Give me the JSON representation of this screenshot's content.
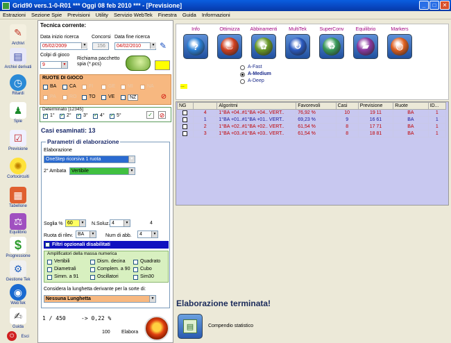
{
  "window": {
    "title": "Grid90 vers.1-0-R01  ***  Oggi 08 feb 2010  ***  - [Previsione]"
  },
  "menu": [
    "Estrazioni",
    "Sezione Spie",
    "Previsioni",
    "Utility",
    "Servizio WebTek",
    "Finestra",
    "Guida",
    "Informazioni"
  ],
  "sidebar": {
    "items": [
      {
        "label": "Archivi"
      },
      {
        "label": "Archivi derivati"
      },
      {
        "label": "Ritardi"
      },
      {
        "label": "Spie"
      },
      {
        "label": "Previsione"
      },
      {
        "label": "Cortocircuiti"
      },
      {
        "label": "Tabellone"
      },
      {
        "label": "Equilibrio"
      },
      {
        "label": "Progressione"
      },
      {
        "label": "Gestione Tek"
      },
      {
        "label": "WebTek"
      },
      {
        "label": "Guida"
      },
      {
        "label": "Esci"
      }
    ]
  },
  "tecnica": {
    "title": "Tecnica corrente:",
    "data_inizio_label": "Data inizio ricerca",
    "data_inizio": "05/02/2009",
    "concorsi_label": "Concorsi",
    "concorsi": "156",
    "data_fine_label": "Data fine ricerca",
    "data_fine": "04/02/2010",
    "colpi_label": "Colpi di gioco",
    "colpi": "9",
    "richiama_label": "Richiama pacchetto spia (*.pcs)",
    "ruote_title": "RUOTE DI GIOCO",
    "ruote": [
      {
        "name": "BA",
        "checked": false,
        "enabled": true
      },
      {
        "name": "CA",
        "checked": false,
        "enabled": true
      },
      {
        "name": "FI",
        "checked": false,
        "enabled": false
      },
      {
        "name": "GE",
        "checked": false,
        "enabled": false
      },
      {
        "name": "MI",
        "checked": false,
        "enabled": false
      },
      {
        "name": "NA",
        "checked": false,
        "enabled": false
      },
      {
        "name": "PA",
        "checked": false,
        "enabled": false
      },
      {
        "name": "RO",
        "checked": false,
        "enabled": false
      },
      {
        "name": "TO",
        "checked": false,
        "enabled": true
      },
      {
        "name": "VE",
        "checked": false,
        "enabled": true
      },
      {
        "name": "NZ",
        "checked": false,
        "enabled": true
      }
    ],
    "determinato_title": "Determinato [12345]",
    "determinato": [
      "1°",
      "2°",
      "3°",
      "4°",
      "5°"
    ],
    "casi_esaminati": "Casi esaminati: 13"
  },
  "parametri": {
    "title": "Parametri di elaborazione",
    "elaborazione_label": "Elaborazione",
    "elaborazione": "OneStep ricorsiva 1 ruota",
    "ambata_label": "2° Ambata",
    "ambata": "Vertibile",
    "soglia_label": "Soglia %",
    "soglia": "60",
    "nsoluz_label": "N.Soluz.",
    "nsoluz": "4",
    "nsoluz_value": "4",
    "ruota_rilev_label": "Ruota di rilev.",
    "ruota_rilev": "BA",
    "num_abb_label": "Num di abb.",
    "num_abb": "4",
    "filtri": "Filtri opzionali disabilitati",
    "amplificatori_title": "Amplificatori della massa numerica",
    "amplificatori": [
      "Vertibili",
      "Diametrali",
      "Simm. a 91",
      "Dism. decina",
      "Complem. a 90",
      "Oscillatori",
      "Quadrato",
      "Cubo",
      "Sim30"
    ],
    "lunghezza_label": "Considera la lunghetta derivante per la sorte di:",
    "lunghezza": "Nessuna Lunghetta"
  },
  "progress": {
    "count": "1 / 450",
    "pct": "-> 0,22 %",
    "value": "100",
    "elabora": "Elabora"
  },
  "tools": [
    {
      "label": "Info",
      "symbol": "?",
      "color": "#2a7fd6"
    },
    {
      "label": "Ottimizza",
      "symbol": "♨",
      "color": "#d04020"
    },
    {
      "label": "Abbinamenti",
      "symbol": "✿",
      "color": "#6a9a2a"
    },
    {
      "label": "MultiTek",
      "symbol": "↻",
      "color": "#2a5ac0"
    },
    {
      "label": "SuperConv",
      "symbol": "♻",
      "color": "#3a9a5a"
    },
    {
      "label": "Equilibrio",
      "symbol": "▰",
      "color": "#8a3aa0"
    },
    {
      "label": "Markers",
      "symbol": "◍",
      "color": "#e06020"
    }
  ],
  "modes": [
    {
      "label": "A-Fast",
      "selected": false
    },
    {
      "label": "A-Medium",
      "selected": true
    },
    {
      "label": "A-Deep",
      "selected": false
    }
  ],
  "table": {
    "headers": [
      "NG",
      "Algoritmi",
      "Favorevoli",
      "Casi",
      "Previsione",
      "Ruote",
      "ID..."
    ],
    "rows": [
      {
        "ng": "4",
        "alg": "1°BA +04..#1°BA +04.. VERT..",
        "fav": "76,92 %",
        "casi": "10",
        "prev": "19 11",
        "ruote": "BA",
        "id": "1",
        "color": "red"
      },
      {
        "ng": "1",
        "alg": "1°BA +01..#1°BA +01.. VERT..",
        "fav": "69,23 %",
        "casi": "9",
        "prev": "16 61",
        "ruote": "BA",
        "id": "1",
        "color": "blue"
      },
      {
        "ng": "2",
        "alg": "1°BA +02..#1°BA +02.. VERT..",
        "fav": "61,54 %",
        "casi": "8",
        "prev": "17 71",
        "ruote": "BA",
        "id": "1",
        "color": "red"
      },
      {
        "ng": "3",
        "alg": "1°BA +03..#1°BA +03.. VERT..",
        "fav": "61,54 %",
        "casi": "8",
        "prev": "18 81",
        "ruote": "BA",
        "id": "1",
        "color": "red"
      }
    ]
  },
  "status": {
    "elaborazione_terminata": "Elaborazione terminata!",
    "compendio": "Compendio statistico"
  },
  "ellipsis": "..."
}
